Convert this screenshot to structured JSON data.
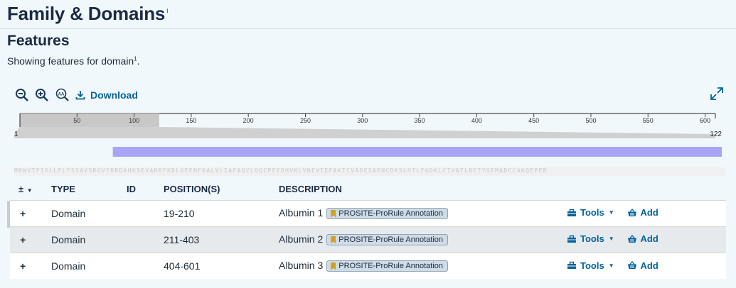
{
  "section": {
    "title": "Family & Domains",
    "title_note": "i"
  },
  "features": {
    "title": "Features",
    "description": "Showing features for domain",
    "description_note": "1",
    "description_end": "."
  },
  "toolbar": {
    "zoom_out_icon": "zoom-out-icon",
    "zoom_in_icon": "zoom-in-icon",
    "aa_icon": "sequence-letters-icon",
    "download_label": "Download",
    "fullscreen_icon": "fullscreen-icon"
  },
  "ruler": {
    "ticks": [
      "50",
      "100",
      "150",
      "200",
      "250",
      "300",
      "350",
      "400",
      "450",
      "500",
      "550",
      "600"
    ],
    "zoom_start": "1",
    "zoom_end": "122",
    "selection_start": 1,
    "selection_end": 122,
    "length": 609
  },
  "domain_track": {
    "color": "#a9a4f5",
    "start": 19,
    "end": 601
  },
  "sequence": "MKWVTFISLLFLFSSAYSRGVFRRDAHKSEVAHRFKDLGEENFKALVLIAFAQYLQQCPFEDHVKLVNEVTEFAKTCVADESAENCDKSLHTLFGDKLCTVATLRETYGEMADCCAKQEPER",
  "table": {
    "sort_label": "±",
    "headers": [
      "TYPE",
      "ID",
      "POSITION(S)",
      "DESCRIPTION"
    ],
    "rows": [
      {
        "expand": "+",
        "type": "Domain",
        "id": "",
        "position": "19-210",
        "description": "Albumin 1",
        "badge": "PROSITE-ProRule Annotation",
        "tools": "Tools",
        "add": "Add"
      },
      {
        "expand": "+",
        "type": "Domain",
        "id": "",
        "position": "211-403",
        "description": "Albumin 2",
        "badge": "PROSITE-ProRule Annotation",
        "tools": "Tools",
        "add": "Add"
      },
      {
        "expand": "+",
        "type": "Domain",
        "id": "",
        "position": "404-601",
        "description": "Albumin 3",
        "badge": "PROSITE-ProRule Annotation",
        "tools": "Tools",
        "add": "Add"
      }
    ]
  },
  "colors": {
    "accent": "#00639a",
    "badge_icon": "#d4a017"
  }
}
